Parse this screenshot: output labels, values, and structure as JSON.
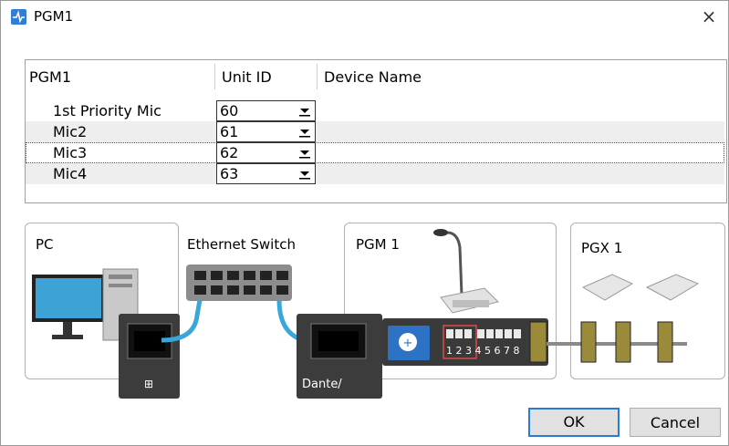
{
  "window": {
    "title": "PGM1",
    "close_glyph": "×"
  },
  "table": {
    "headers": {
      "name": "PGM1",
      "unit_id": "Unit ID",
      "device_name": "Device Name"
    },
    "rows": [
      {
        "name": "1st Priority Mic",
        "unit_id": "60",
        "device_name": ""
      },
      {
        "name": "Mic2",
        "unit_id": "61",
        "device_name": ""
      },
      {
        "name": "Mic3",
        "unit_id": "62",
        "device_name": ""
      },
      {
        "name": "Mic4",
        "unit_id": "63",
        "device_name": ""
      }
    ]
  },
  "diagram": {
    "pc_label": "PC",
    "switch_label": "Ethernet Switch",
    "pgm_label": "PGM 1",
    "pgx_label": "PGX 1",
    "dante_label": "Dante/",
    "dip_numbers": "1 2 3 4 5 6 7 8"
  },
  "buttons": {
    "ok": "OK",
    "cancel": "Cancel"
  },
  "colors": {
    "accent": "#2b7bd6",
    "cable": "#3aa6dc",
    "rotary": "#2d72c4"
  }
}
